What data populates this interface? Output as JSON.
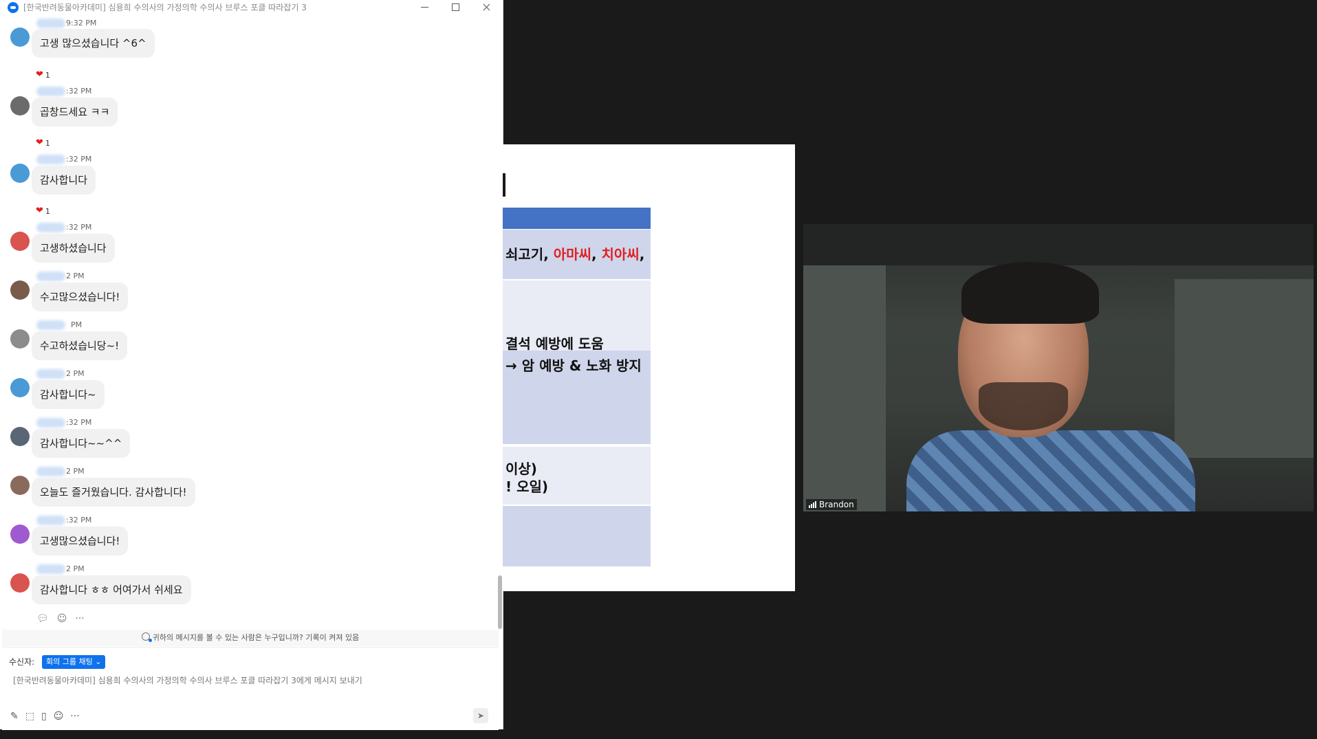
{
  "window": {
    "title": "[한국반려동물아카데미] 심용희 수의사의 가정의학 수의사 브루스 포클 따라잡기 3"
  },
  "messages": [
    {
      "time": "9:32 PM",
      "text": "고생 많으셨습니다 ^6^",
      "avatar_color": "#4a9ad6",
      "reaction": {
        "icon": "heart-icon",
        "count": "1"
      }
    },
    {
      "time": ":32 PM",
      "text": "곱창드세요 ㅋㅋ",
      "avatar_color": "#6b6b6b",
      "reaction": {
        "icon": "heart-icon",
        "count": "1"
      }
    },
    {
      "time": ":32 PM",
      "text": "감사합니다",
      "avatar_color": "#4a9ad6",
      "reaction": {
        "icon": "heart-icon",
        "count": "1"
      }
    },
    {
      "time": ":32 PM",
      "text": "고생하셨습니다",
      "avatar_color": "#d9534f"
    },
    {
      "time": "2 PM",
      "text": "수고많으셨습니다!",
      "avatar_color": "#7a5a4a"
    },
    {
      "time": "PM",
      "text": "수고하셨습니당~!",
      "avatar_color": "#8c8c8c"
    },
    {
      "time": "2 PM",
      "text": "감사합니다~",
      "avatar_color": "#4a9ad6"
    },
    {
      "time": ":32 PM",
      "text": "감사합니다~~^^",
      "avatar_color": "#5a6575"
    },
    {
      "time": "2 PM",
      "text": "오늘도 즐거웠습니다. 감사합니다!",
      "avatar_color": "#8a6a5a"
    },
    {
      "time": ":32 PM",
      "text": "고생많으셨습니다!",
      "avatar_color": "#a05ad0"
    },
    {
      "time": "2 PM",
      "text": "감사합니다 ㅎㅎ 어여가서 쉬세요",
      "avatar_color": "#d9534f"
    }
  ],
  "message_actions": [
    "reply-icon",
    "emoji-icon",
    "more-icon"
  ],
  "privacy_notice": "귀하의 메시지를 볼 수 있는 사람은 누구입니까? 기록이 켜져 있음",
  "composer": {
    "recipient_label": "수신자:",
    "recipient_value": "회의 그룹 채팅",
    "placeholder": "[한국반려동물아카데미] 심용희 수의사의 가정의학 수의사 브루스 포클 따라잡기 3에게 메시지 보내기"
  },
  "slide": {
    "row1_prefix": "쇠고기, ",
    "row1_red1": "아마씨",
    "row1_sep": ", ",
    "row1_red2": "치아씨",
    "row1_suffix": ",",
    "row2_line1": "",
    "row2_line2": "",
    "row2_line3": "결석 예방에 도움",
    "row3_line1": "→ 암 예방 & 노화 방지",
    "row4_line1": "이상)",
    "row4_line2": "! 오일)"
  },
  "video": {
    "participant_name": "Brandon"
  },
  "colors": {
    "accent": "#0e72ed",
    "slide_header": "#4472c4",
    "slide_row": "#cfd5ea",
    "highlight_red": "#e02020"
  }
}
